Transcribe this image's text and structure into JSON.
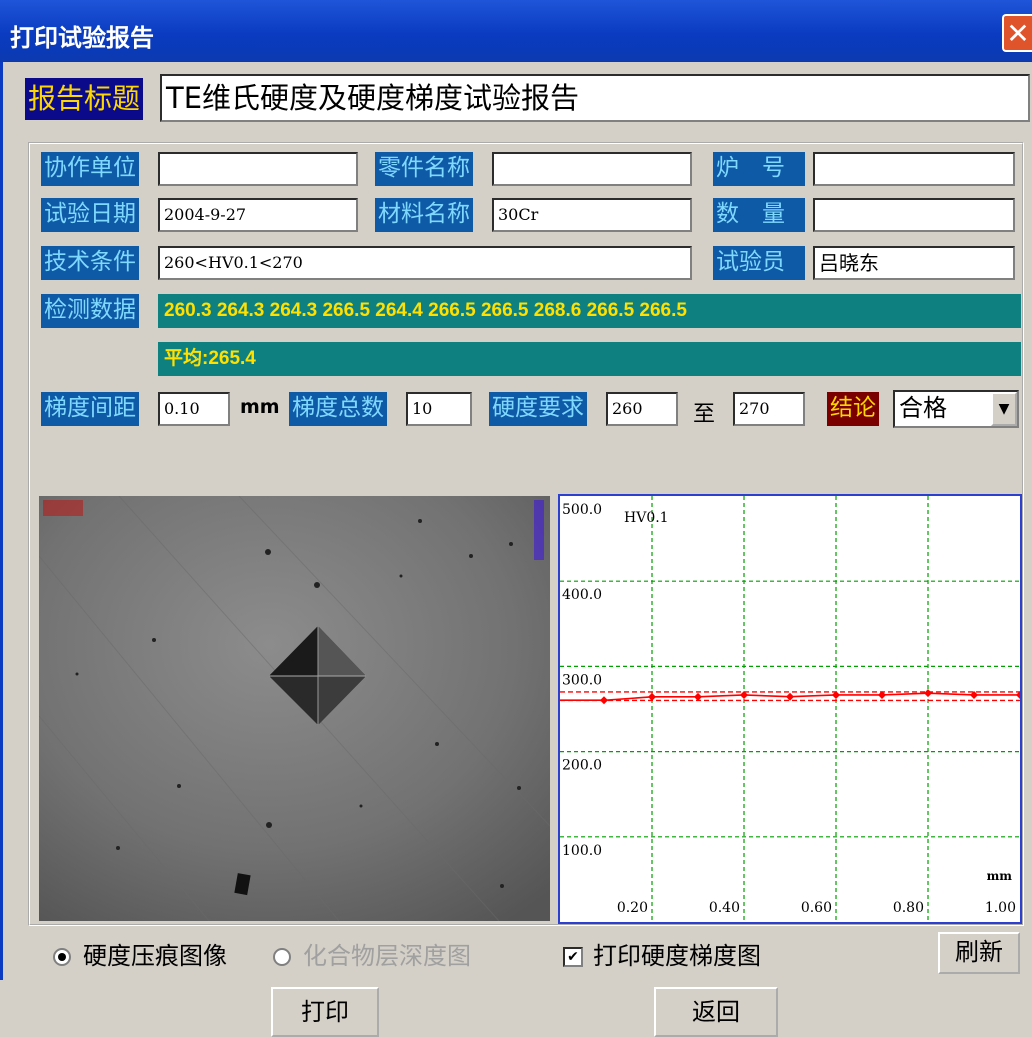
{
  "window": {
    "title": "打印试验报告",
    "close": "✕"
  },
  "report_title": {
    "label": "报告标题",
    "value": "TE维氏硬度及硬度梯度试验报告"
  },
  "fields": {
    "coop_unit": {
      "label": "协作单位",
      "value": ""
    },
    "part_name": {
      "label": "零件名称",
      "value": ""
    },
    "furnace_no": {
      "label": "炉　号",
      "value": ""
    },
    "test_date": {
      "label": "试验日期",
      "value": "2004-9-27"
    },
    "material": {
      "label": "材料名称",
      "value": "30Cr"
    },
    "quantity": {
      "label": "数　量",
      "value": ""
    },
    "tech_cond": {
      "label": "技术条件",
      "value": "260<HV0.1<270"
    },
    "tester": {
      "label": "试验员",
      "value": "吕晓东"
    }
  },
  "data": {
    "label": "检测数据",
    "values": "260.3 264.3 264.3 266.5 264.4 266.5 266.5 268.6 266.5 266.5",
    "average": "平均:265.4"
  },
  "params": {
    "spacing_label": "梯度间距",
    "spacing": "0.10",
    "spacing_unit": "mm",
    "count_label": "梯度总数",
    "count": "10",
    "req_label": "硬度要求",
    "req_min": "260",
    "req_to": "至",
    "req_max": "270",
    "conclusion_label": "结论",
    "conclusion": "合格"
  },
  "chart_data": {
    "type": "line",
    "ylabel": "HV0.1",
    "xlabel": "mm",
    "ylim": [
      0,
      500
    ],
    "xlim": [
      0,
      1.0
    ],
    "yticks": [
      "500.0",
      "400.0",
      "300.0",
      "200.0",
      "100.0"
    ],
    "xticks": [
      "0.20",
      "0.40",
      "0.60",
      "0.80",
      "1.00"
    ],
    "x": [
      0.1,
      0.2,
      0.3,
      0.4,
      0.5,
      0.6,
      0.7,
      0.8,
      0.9,
      1.0
    ],
    "values": [
      260.3,
      264.3,
      264.3,
      266.5,
      264.4,
      266.5,
      266.5,
      268.6,
      266.5,
      266.5
    ],
    "limits": [
      260,
      270
    ],
    "grid": true,
    "colors": {
      "series": "#ff0000",
      "grid": "#00a000",
      "axis": "#2b3fd0"
    }
  },
  "options": {
    "radio1": "硬度压痕图像",
    "radio2": "化合物层深度图",
    "check": "打印硬度梯度图",
    "refresh": "刷新"
  },
  "buttons": {
    "print": "打印",
    "back": "返回"
  }
}
